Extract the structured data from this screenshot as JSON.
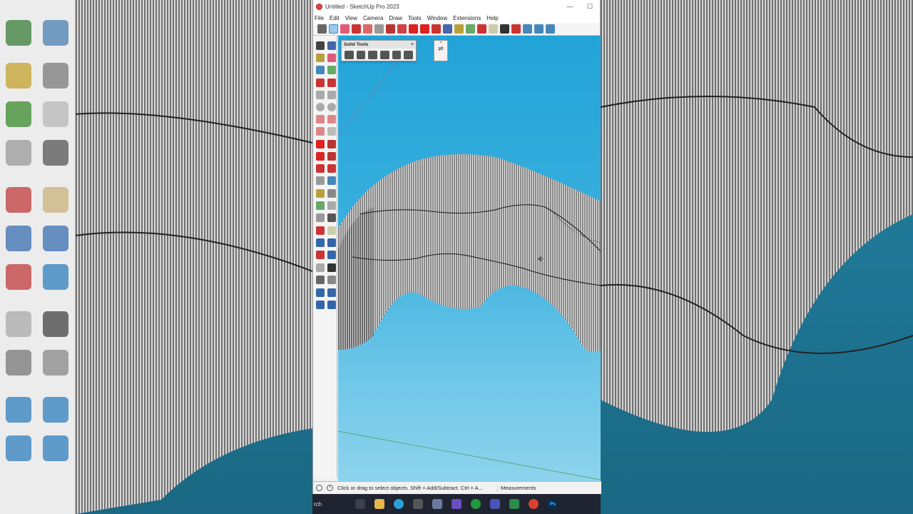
{
  "window": {
    "title": "Untitled - SketchUp Pro 2023",
    "minimize_glyph": "—",
    "maximize_glyph": "☐"
  },
  "menu": [
    "File",
    "Edit",
    "View",
    "Camera",
    "Draw",
    "Tools",
    "Window",
    "Extensions",
    "Help"
  ],
  "solid_tools": {
    "title": "Solid Tools",
    "close_glyph": "×"
  },
  "statusbar": {
    "hint": "Click or drag to select objects. Shift = Add/Subtract. Ctrl = A...",
    "measurements_label": "Measurements"
  },
  "taskbar": {
    "search_text": "rch",
    "apps": [
      "task-view",
      "file-explorer",
      "edge",
      "settings",
      "store",
      "visual-studio",
      "xbox",
      "teams",
      "terminal",
      "chrome",
      "photoshop"
    ]
  },
  "colors": {
    "sky_top": "#21a3d8",
    "sky_bottom": "#8dd3ec",
    "taskbar": "#1f2430",
    "mesh_stroke": "#2b2b2b"
  }
}
